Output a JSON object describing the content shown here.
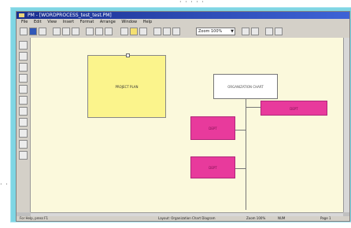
{
  "window": {
    "title": "PM - [WORDPROCESS_test_test.PM]",
    "menu": [
      "File",
      "Edit",
      "View",
      "Insert",
      "Format",
      "Arrange",
      "Window",
      "Help"
    ]
  },
  "toolbar": {
    "zoom": "Zoom 100%"
  },
  "canvas": {
    "yellow_node": "PROJECT PLAN",
    "top_node": "ORGANIZATION CHART",
    "pink_right": "DEPT",
    "pink_left_top": "DEPT",
    "pink_left_bottom": "DEPT"
  },
  "status": {
    "left": "For Help, press F1",
    "mid": "Layout: Organization Chart Diagram",
    "right1": "Zoom 100%",
    "right2": "NUM",
    "right3": "Page 1"
  },
  "colors": {
    "canvas": "#fbf9dc",
    "yellow": "#fbf48c",
    "pink": "#e83a9c",
    "frame": "#7fd6e4"
  }
}
